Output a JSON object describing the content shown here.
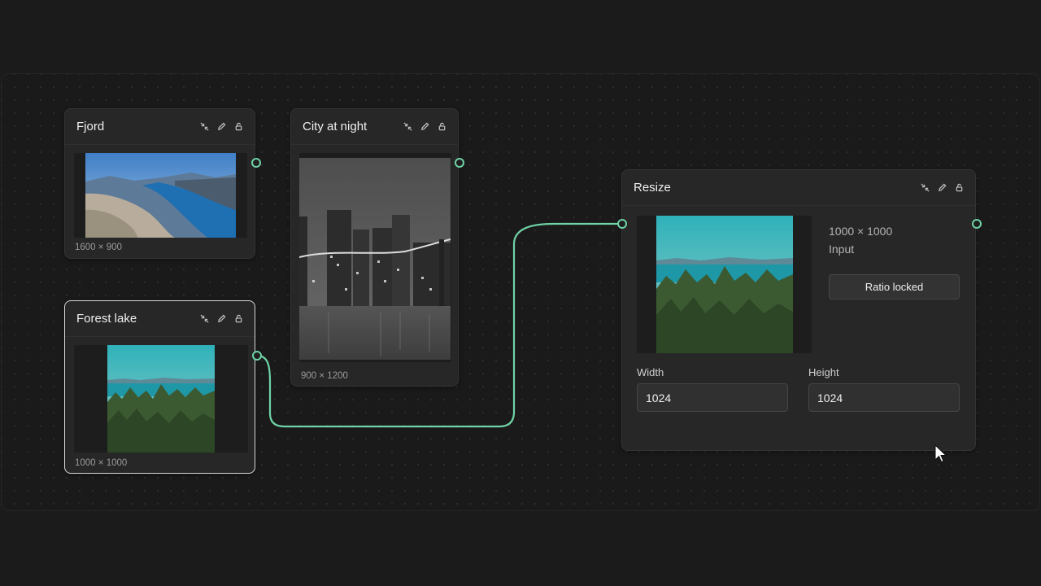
{
  "nodes": {
    "fjord": {
      "title": "Fjord",
      "dims": "1600 × 900"
    },
    "city": {
      "title": "City at night",
      "dims": "900 × 1200"
    },
    "forest": {
      "title": "Forest lake",
      "dims": "1000 × 1000"
    },
    "resize": {
      "title": "Resize",
      "info_dims": "1000 × 1000",
      "info_source": "Input",
      "ratio_button": "Ratio locked",
      "width_label": "Width",
      "width_value": "1024",
      "height_label": "Height",
      "height_value": "1024"
    }
  },
  "icons": {
    "collapse": "collapse-icon",
    "edit": "pencil-icon",
    "lock": "unlock-icon"
  },
  "colors": {
    "accent": "#6fd3a6",
    "background": "#1b1b1b",
    "node": "#272727"
  }
}
